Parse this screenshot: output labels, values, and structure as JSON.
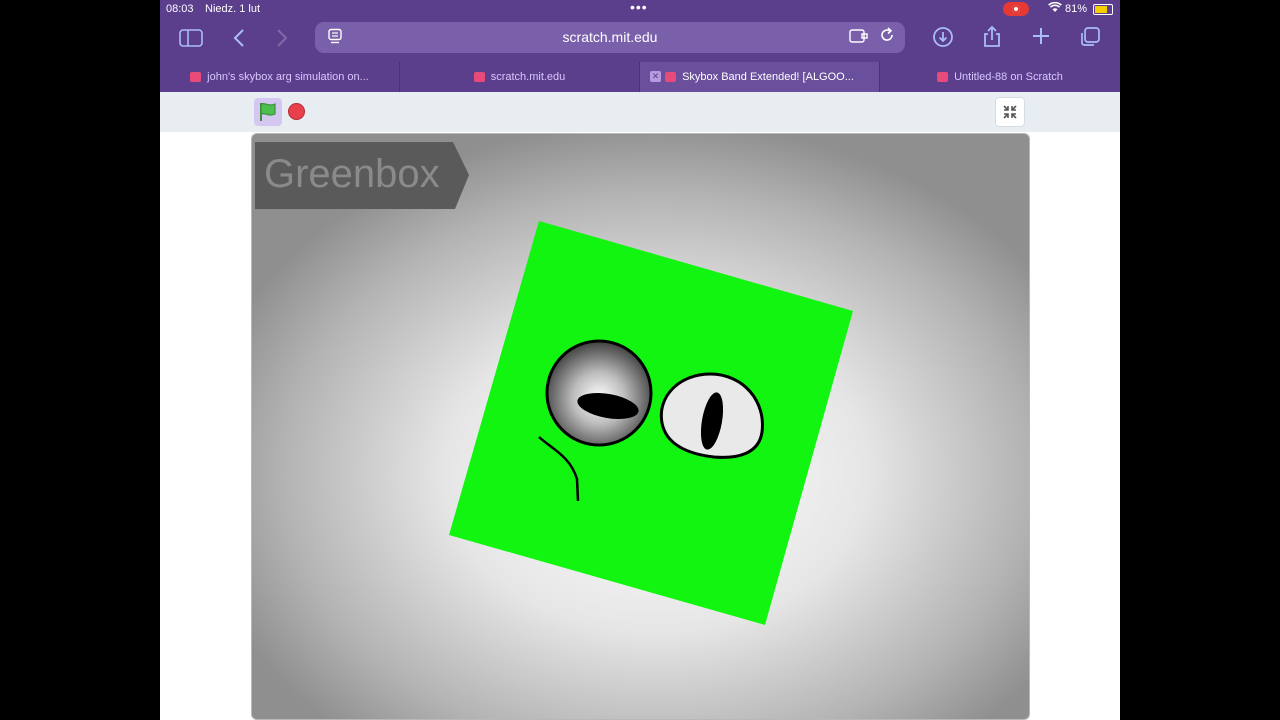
{
  "status": {
    "time": "08:03",
    "date": "Niedz. 1 lut",
    "battery": "81%"
  },
  "browser": {
    "url": "scratch.mit.edu"
  },
  "tabs": [
    {
      "title": "john's skybox arg simulation on..."
    },
    {
      "title": "scratch.mit.edu"
    },
    {
      "title": "Skybox Band Extended! [ALGOO..."
    },
    {
      "title": "Untitled-88 on Scratch"
    }
  ],
  "stage": {
    "title": "Greenbox",
    "character_color": "#11f511"
  }
}
